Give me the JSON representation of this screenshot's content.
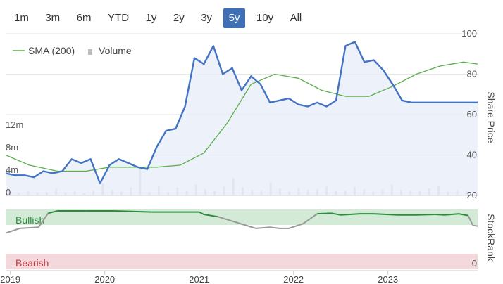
{
  "range_selector": {
    "options": [
      "1m",
      "3m",
      "6m",
      "YTD",
      "1y",
      "2y",
      "3y",
      "5y",
      "10y",
      "All"
    ],
    "selected": "5y"
  },
  "legend": {
    "sma_label": "SMA (200)",
    "volume_label": "Volume"
  },
  "colors": {
    "price": "#4472c4",
    "price_fill": "#e8eef8",
    "sma": "#5aae4a",
    "volume": "#c9c9c9",
    "bullish_zone": "#d3ebd6",
    "bearish_zone": "#f4d9dc",
    "bullish_line": "#2e8b3e",
    "neutral_line": "#999999",
    "active_button": "#3f6fb5"
  },
  "chart_data": [
    {
      "type": "line",
      "ylabel": "Share Price",
      "y_ticks": [
        20,
        40,
        60,
        80,
        100
      ],
      "ylim": [
        20,
        100
      ],
      "x_ticks": [
        "2019",
        "2020",
        "2021",
        "2022",
        "2023"
      ],
      "xlim": [
        2018.95,
        2023.95
      ],
      "series": [
        {
          "name": "",
          "x": [
            2018.95,
            2019.05,
            2019.15,
            2019.25,
            2019.35,
            2019.45,
            2019.55,
            2019.65,
            2019.75,
            2019.85,
            2019.95,
            2020.05,
            2020.15,
            2020.25,
            2020.35,
            2020.45,
            2020.55,
            2020.65,
            2020.75,
            2020.85,
            2020.95,
            2021.05,
            2021.15,
            2021.25,
            2021.35,
            2021.45,
            2021.55,
            2021.65,
            2021.75,
            2021.85,
            2021.95,
            2022.05,
            2022.15,
            2022.25,
            2022.35,
            2022.45,
            2022.55,
            2022.65,
            2022.75,
            2022.85,
            2022.95,
            2023.05,
            2023.15,
            2023.25,
            2023.35,
            2023.45,
            2023.55,
            2023.65,
            2023.75,
            2023.85,
            2023.95
          ],
          "values": [
            31,
            30,
            30,
            29,
            32,
            31,
            32,
            38,
            36,
            38,
            26,
            35,
            38,
            36,
            34,
            33,
            44,
            52,
            53,
            64,
            88,
            85,
            94,
            80,
            83,
            72,
            79,
            75,
            66,
            67,
            68,
            65,
            64,
            66,
            64,
            67,
            94,
            96,
            86,
            87,
            82,
            75,
            67,
            66,
            66,
            66,
            66,
            66,
            66,
            66,
            66
          ]
        },
        {
          "name": "SMA (200)",
          "x": [
            2018.95,
            2019.2,
            2019.5,
            2019.8,
            2020.05,
            2020.3,
            2020.55,
            2020.8,
            2021.05,
            2021.3,
            2021.55,
            2021.8,
            2022.05,
            2022.3,
            2022.55,
            2022.8,
            2023.05,
            2023.3,
            2023.55,
            2023.8,
            2023.95
          ],
          "values": [
            40,
            35,
            32,
            32,
            34,
            34,
            34,
            35,
            41,
            56,
            75,
            80,
            78,
            72,
            69,
            69,
            74,
            80,
            84,
            86,
            85
          ]
        }
      ]
    },
    {
      "type": "bar",
      "ylabel": "",
      "y_ticks_labels": [
        "0",
        "4m",
        "8m",
        "12m"
      ],
      "ylim": [
        0,
        12
      ],
      "notes": "Volume bars (millions) below price chart",
      "values": [
        1.2,
        0.8,
        1.5,
        0.9,
        1.1,
        2.2,
        1.0,
        1.3,
        0.7,
        1.6,
        3.8,
        1.8,
        1.2,
        2.5,
        8.6,
        1.0,
        3.2,
        1.0,
        2.5,
        1.4,
        3.6,
        2.0,
        1.4,
        3.0,
        5.5,
        2.6,
        1.8,
        1.6,
        4.2,
        2.2,
        1.2,
        2.4,
        1.8,
        2.0,
        3.0,
        1.4,
        1.6,
        2.8,
        2.0,
        1.2,
        2.0,
        3.5,
        1.8,
        1.6,
        1.4,
        2.2,
        3.2,
        1.2,
        1.8,
        1.4
      ]
    },
    {
      "type": "line",
      "ylabel": "StockRank",
      "top_label": "Bullish",
      "bottom_label": "Bearish",
      "right_top_tick": "",
      "right_bottom_tick": "0",
      "x_ticks": [
        "2019",
        "2020",
        "2021",
        "2022",
        "2023"
      ],
      "series": [
        {
          "name": "",
          "x": [
            2018.95,
            2019.1,
            2019.3,
            2019.4,
            2019.5,
            2019.8,
            2020.1,
            2020.5,
            2021.0,
            2021.05,
            2021.2,
            2021.5,
            2021.6,
            2021.75,
            2021.85,
            2021.95,
            2022.1,
            2022.25,
            2022.4,
            2022.5,
            2022.7,
            2022.85,
            2023.1,
            2023.3,
            2023.5,
            2023.6,
            2023.75,
            2023.85,
            2023.9,
            2023.95
          ],
          "values": [
            0.62,
            0.7,
            0.72,
            0.96,
            1.0,
            1.0,
            1.0,
            0.98,
            0.98,
            0.94,
            0.9,
            0.75,
            0.7,
            0.72,
            0.7,
            0.7,
            0.78,
            0.95,
            0.96,
            0.93,
            0.95,
            0.95,
            0.93,
            0.93,
            0.94,
            0.93,
            0.95,
            0.92,
            0.75,
            0.74
          ]
        }
      ]
    }
  ]
}
